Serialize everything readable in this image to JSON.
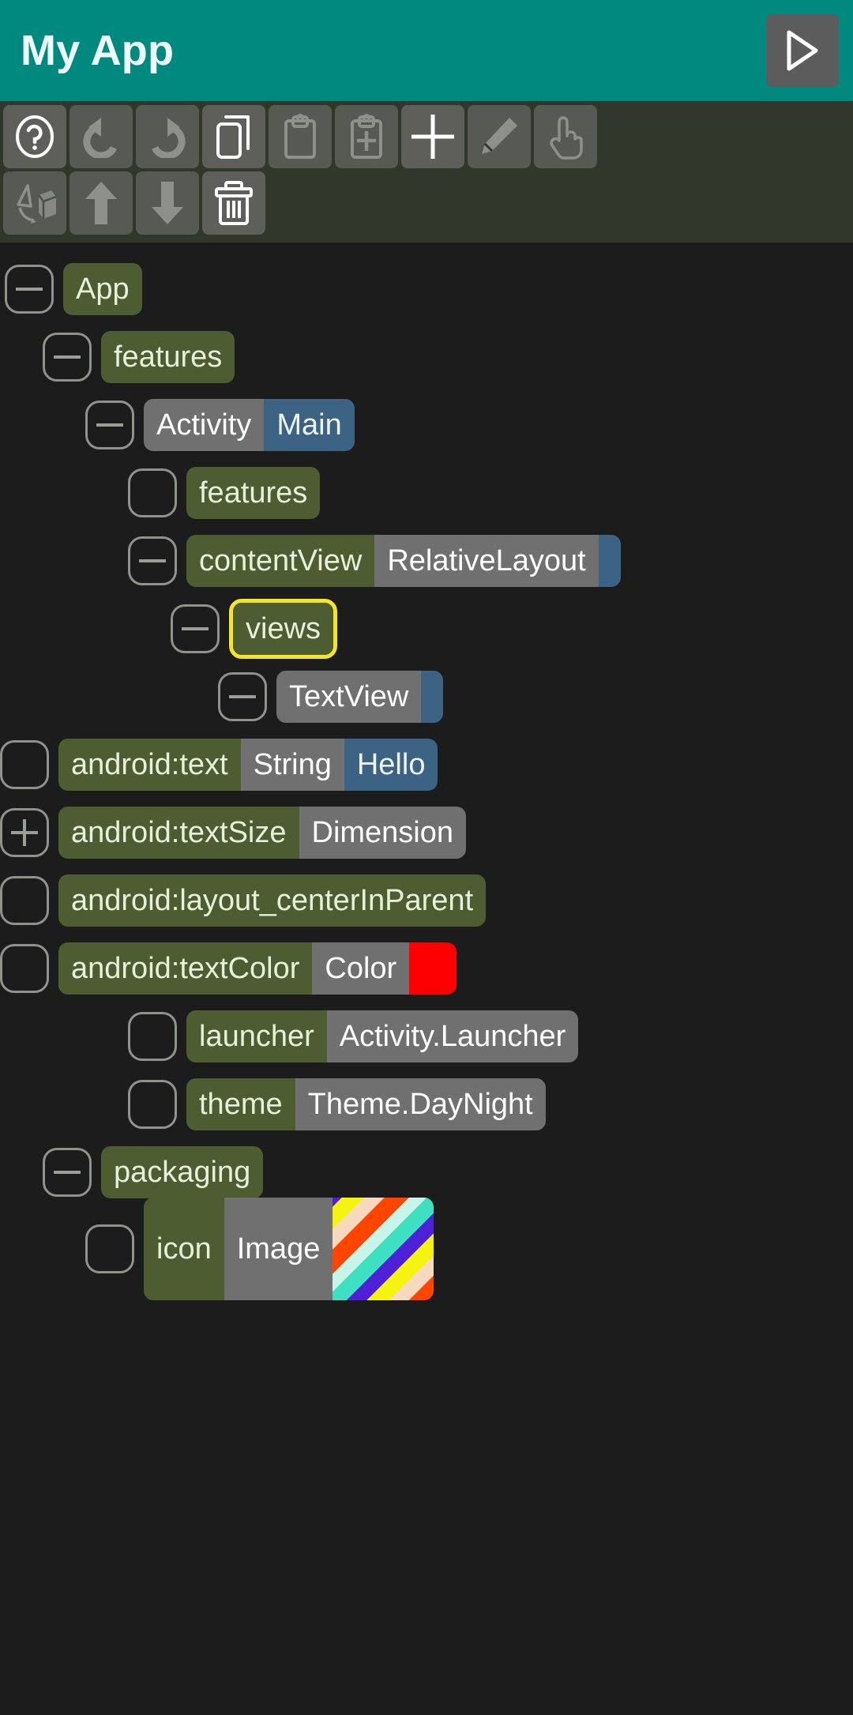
{
  "appbar": {
    "title": "My App",
    "run_button": "run-icon"
  },
  "toolbar": {
    "rows": [
      [
        {
          "name": "help-icon",
          "enabled": true
        },
        {
          "name": "undo-icon",
          "enabled": false
        },
        {
          "name": "redo-icon",
          "enabled": false
        },
        {
          "name": "copy-icon",
          "enabled": true
        },
        {
          "name": "paste-icon",
          "enabled": false
        },
        {
          "name": "paste-add-icon",
          "enabled": false
        },
        {
          "name": "add-icon",
          "enabled": true
        },
        {
          "name": "edit-icon",
          "enabled": false
        },
        {
          "name": "select-icon",
          "enabled": false
        }
      ],
      [
        {
          "name": "rotate-3d-icon",
          "enabled": false
        },
        {
          "name": "move-up-icon",
          "enabled": false
        },
        {
          "name": "move-down-icon",
          "enabled": false
        },
        {
          "name": "delete-icon",
          "enabled": true
        }
      ]
    ]
  },
  "tree": {
    "nodes": [
      {
        "id": "app",
        "indent": 0,
        "toggle": "minus",
        "name": "App",
        "type": null,
        "value": null,
        "selected": false
      },
      {
        "id": "features",
        "indent": 1,
        "toggle": "minus",
        "name": "features",
        "type": null,
        "value": null,
        "selected": false
      },
      {
        "id": "activity-main",
        "indent": 2,
        "toggle": "minus",
        "name": null,
        "type": "Activity",
        "value": "Main",
        "selected": false
      },
      {
        "id": "features-2",
        "indent": 3,
        "toggle": "leaf",
        "name": "features",
        "type": null,
        "value": null,
        "selected": false
      },
      {
        "id": "contentview",
        "indent": 3,
        "toggle": "minus",
        "name": "contentView",
        "type": "RelativeLayout",
        "value": "",
        "selected": false
      },
      {
        "id": "views",
        "indent": 4,
        "toggle": "minus",
        "name": "views",
        "type": null,
        "value": null,
        "selected": true
      },
      {
        "id": "textview",
        "indent": 5,
        "toggle": "minus",
        "name": null,
        "type": "TextView",
        "value": "",
        "selected": false
      },
      {
        "id": "android-text",
        "indent": 6,
        "toggle": "leaf",
        "name": "android:text",
        "type": "String",
        "value": "Hello",
        "selected": false
      },
      {
        "id": "android-textsize",
        "indent": 6,
        "toggle": "plus",
        "name": "android:textSize",
        "type": "Dimension",
        "value": null,
        "selected": false
      },
      {
        "id": "android-centerinparent",
        "indent": 6,
        "toggle": "leaf",
        "name": "android:layout_centerInParent",
        "type": null,
        "value": null,
        "selected": false
      },
      {
        "id": "android-textcolor",
        "indent": 6,
        "toggle": "leaf",
        "name": "android:textColor",
        "type": "Color",
        "value": null,
        "swatch": "#ff0000",
        "selected": false
      },
      {
        "id": "launcher",
        "indent": 3,
        "toggle": "leaf",
        "name": "launcher",
        "type": "Activity.Launcher",
        "value": null,
        "selected": false
      },
      {
        "id": "theme",
        "indent": 3,
        "toggle": "leaf",
        "name": "theme",
        "type": "Theme.DayNight",
        "value": null,
        "selected": false
      },
      {
        "id": "packaging",
        "indent": 1,
        "toggle": "minus",
        "name": "packaging",
        "type": null,
        "value": null,
        "selected": false
      },
      {
        "id": "icon",
        "indent": 2,
        "toggle": "leaf",
        "name": "icon",
        "type": "Image",
        "value": null,
        "image": "rainbow-stripes",
        "selected": false
      }
    ]
  },
  "colors": {
    "appbar": "#00897f",
    "toolbar_bg": "#32372c",
    "canvas_bg": "#1c1c1c",
    "chip_name": "#4e5c32",
    "chip_type": "#707070",
    "chip_value": "#3d6384",
    "selection_outline": "#f5e625",
    "color_swatch": "#ff0000"
  }
}
